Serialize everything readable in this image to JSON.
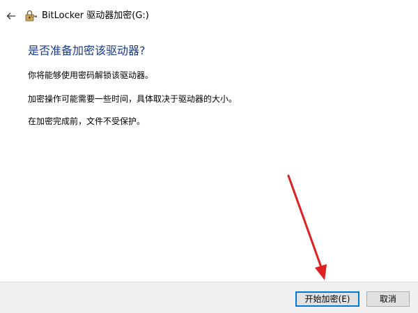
{
  "window": {
    "title": "BitLocker 驱动器加密(G:)",
    "back_icon": "back-arrow-icon",
    "app_icon": "bitlocker-key-icon"
  },
  "content": {
    "heading": "是否准备加密该驱动器?",
    "paragraphs": [
      "你将能够使用密码解锁该驱动器。",
      "加密操作可能需要一些时间，具体取决于驱动器的大小。",
      "在加密完成前，文件不受保护。"
    ],
    "heading_color": "#1a3a8e"
  },
  "footer": {
    "start_label": "开始加密(E)",
    "cancel_label": "取消"
  },
  "annotation": {
    "type": "arrow",
    "color": "#e02020",
    "target": "start-encryption-button"
  }
}
